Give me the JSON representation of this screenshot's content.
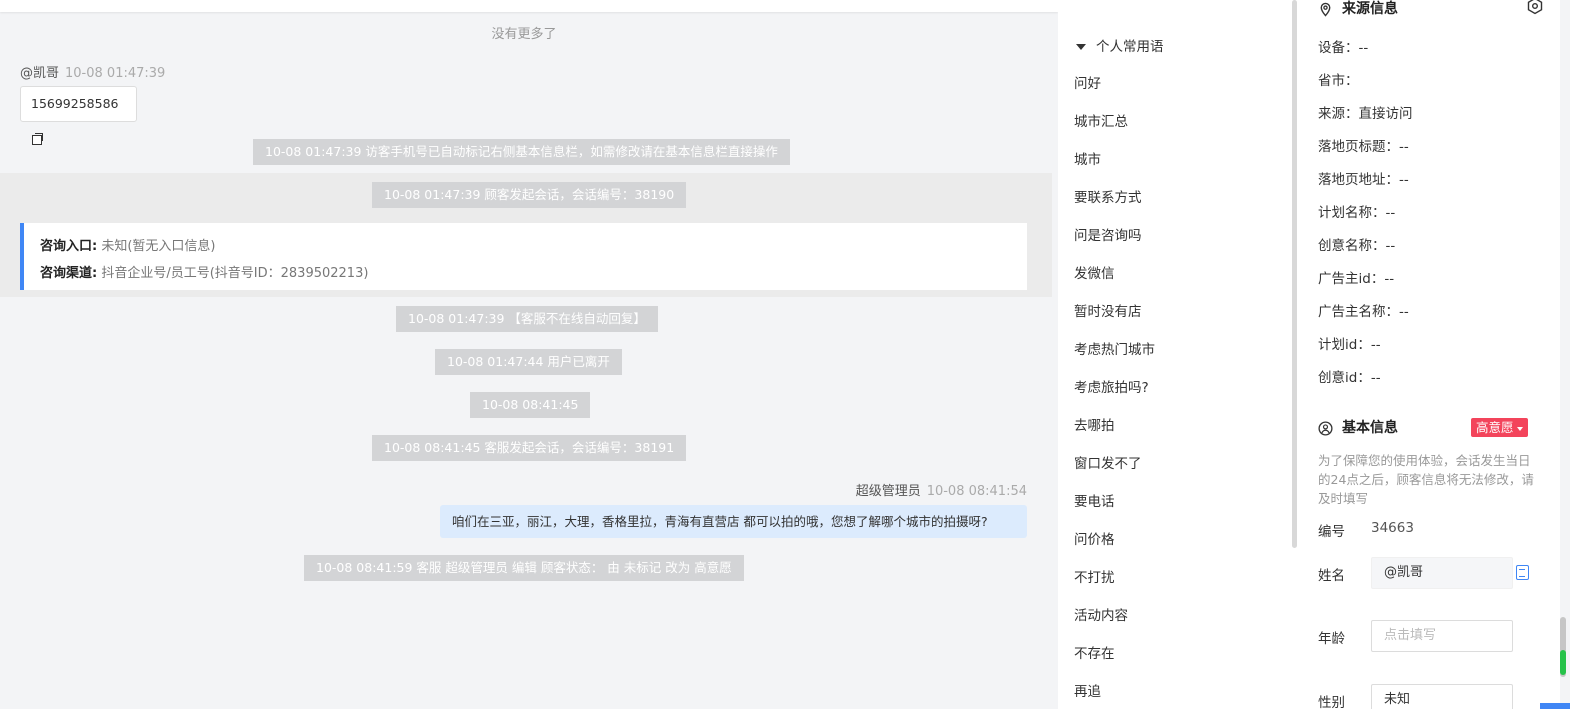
{
  "chat": {
    "no_more": "没有更多了",
    "visitor_name": "@凯哥",
    "visitor_time": "10-08 01:47:39",
    "phone": "15699258586",
    "system_messages": [
      "10-08 01:47:39 访客手机号已自动标记右侧基本信息栏，如需修改请在基本信息栏直接操作",
      "10-08 01:47:39 顾客发起会话，会话编号：38190",
      "10-08 01:47:39 【客服不在线自动回复】",
      "10-08 01:47:44 用户已离开",
      "10-08 08:41:45",
      "10-08 08:41:45 客服发起会话，会话编号：38191",
      "10-08 08:41:59 客服 超级管理员 编辑 顾客状态： 由 未标记 改为 高意愿"
    ],
    "consult": {
      "entry_label": "咨询入口:",
      "entry_value": "未知(暂无入口信息)",
      "channel_label": "咨询渠道:",
      "channel_value": "抖音企业号/员工号(抖音号ID：2839502213)"
    },
    "agent_name": "超级管理员",
    "agent_time": "10-08 08:41:54",
    "agent_message": "咱们在三亚，丽江，大理，香格里拉，青海有直营店 都可以拍的哦，您想了解哪个城市的拍摄呀?"
  },
  "phrases": {
    "header": "个人常用语",
    "items": [
      "问好",
      "城市汇总",
      "城市",
      "要联系方式",
      "问是咨询吗",
      "发微信",
      "暂时没有店",
      "考虑热门城市",
      "考虑旅拍吗?",
      "去哪拍",
      "窗口发不了",
      "要电话",
      "问价格",
      "不打扰",
      "活动内容",
      "不存在",
      "再追"
    ]
  },
  "source_info": {
    "title": "来源信息",
    "rows": [
      "设备：--",
      "省市：",
      "来源：直接访问",
      "落地页标题：--",
      "落地页地址：--",
      "计划名称：--",
      "创意名称：--",
      "广告主id：--",
      "广告主名称：--",
      "计划id：--",
      "创意id：--"
    ]
  },
  "basic_info": {
    "title": "基本信息",
    "intent_tag": "高意愿",
    "hint": "为了保障您的使用体验，会话发生当日的24点之后，顾客信息将无法修改，请及时填写",
    "id_label": "编号",
    "id_value": "34663",
    "name_label": "姓名",
    "name_value": "@凯哥",
    "age_label": "年龄",
    "age_placeholder": "点击填写",
    "gender_label": "性别",
    "gender_value": "未知"
  },
  "colors": {
    "accent": "#3f86f5",
    "tag_red": "#f3445b",
    "system_bubble": "#d3d4d6",
    "agent_bubble": "#dcebfd"
  }
}
